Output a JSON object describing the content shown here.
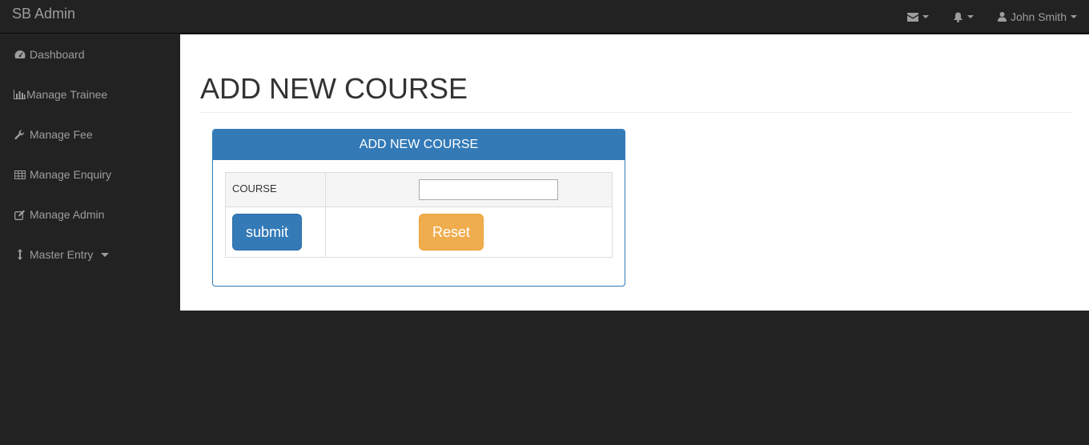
{
  "topbar": {
    "brand": "SB Admin",
    "user_name": "John Smith",
    "icons": [
      "envelope-icon",
      "bell-icon",
      "user-icon"
    ]
  },
  "sidebar": {
    "items": [
      {
        "label": "Dashboard",
        "icon": "dashboard-icon"
      },
      {
        "label": "Manage Trainee",
        "icon": "bar-chart-icon"
      },
      {
        "label": "Manage Fee",
        "icon": "wrench-icon"
      },
      {
        "label": "Manage Enquiry",
        "icon": "table-icon"
      },
      {
        "label": "Manage Admin",
        "icon": "edit-icon"
      },
      {
        "label": "Master Entry",
        "icon": "vertical-arrows-icon"
      }
    ]
  },
  "main": {
    "page_title": "ADD NEW COURSE",
    "panel": {
      "heading": "ADD NEW COURSE",
      "course_label": "COURSE",
      "course_value": "",
      "course_placeholder": "",
      "submit_label": "submit",
      "reset_label": "Reset"
    }
  },
  "colors": {
    "navbar": "#222222",
    "primary": "#337ab7",
    "warning": "#f0ad4e",
    "nav_text": "#9d9d9d"
  }
}
